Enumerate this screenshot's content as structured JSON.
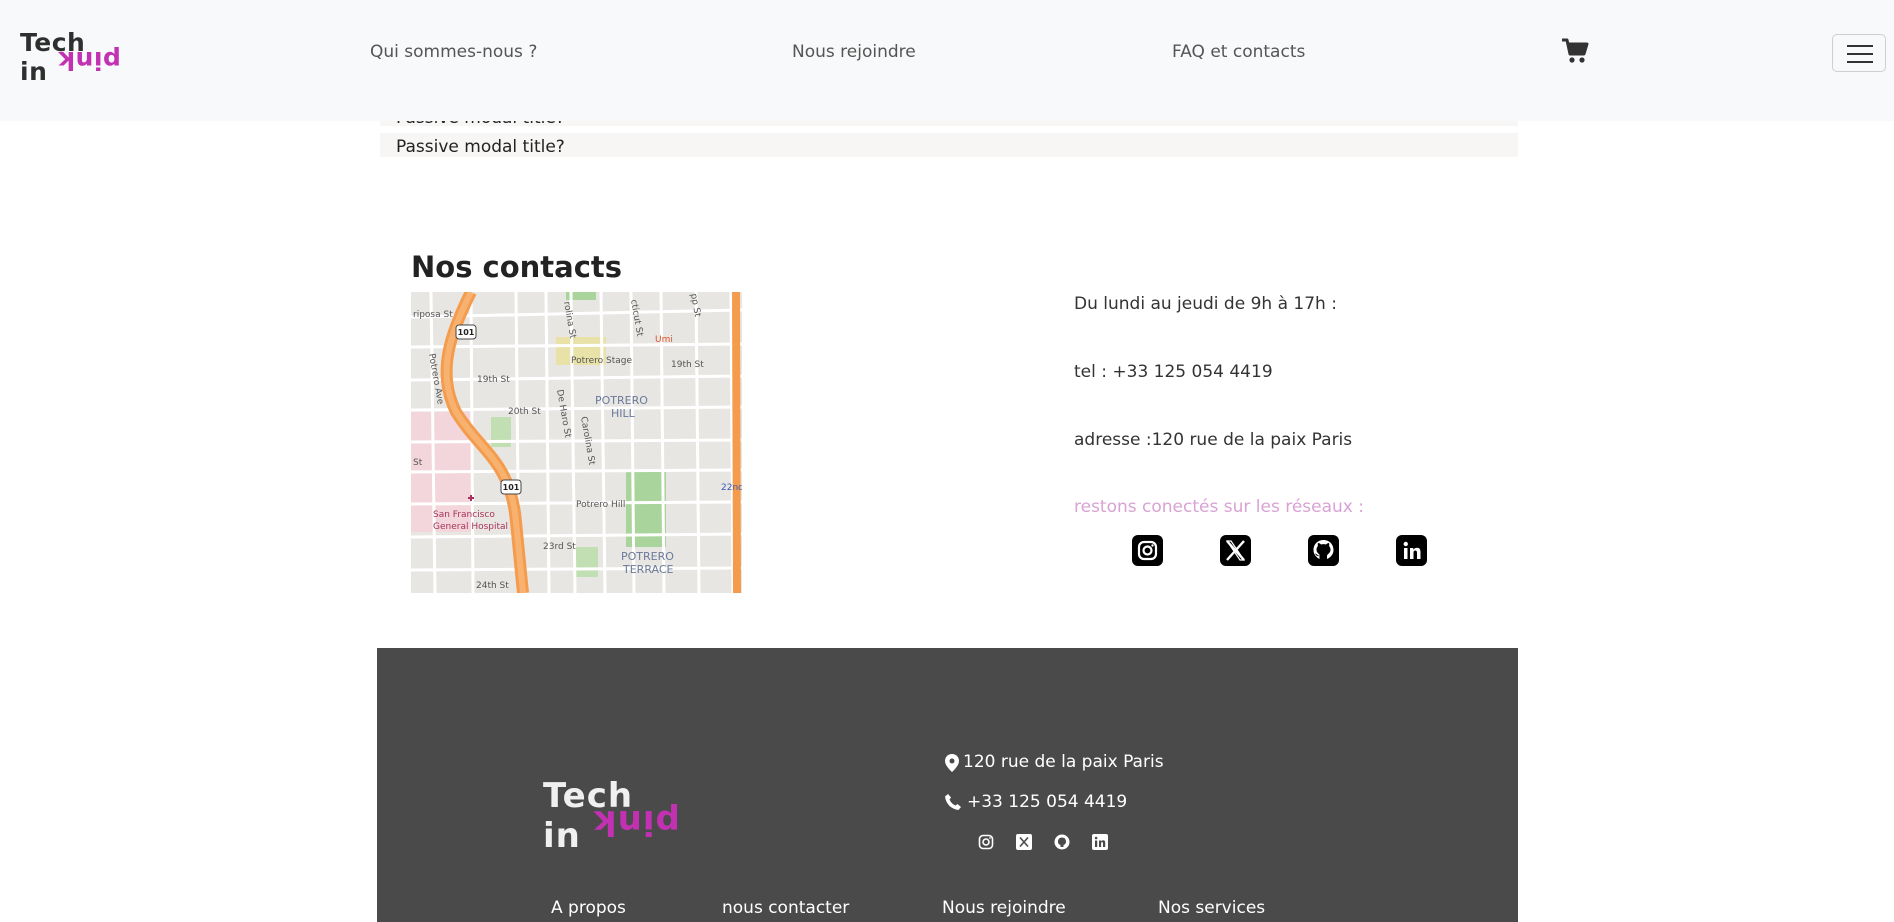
{
  "navbar": {
    "logo_top": "Tech in",
    "logo_bottom": "pink",
    "links": [
      "Qui sommes-nous ?",
      "Nous rejoindre",
      "FAQ et contacts"
    ],
    "cart_icon": "cart-icon",
    "menu_icon": "hamburger-icon"
  },
  "accordion": {
    "items": [
      "Passive modal title?",
      "Passive modal title?"
    ]
  },
  "contacts": {
    "title": "Nos contacts",
    "map_labels": {
      "mariposa": "riposa St",
      "potrero_ave": "Potrero Ave",
      "potrero_stage": "Potrero Stage",
      "umi": "Umi",
      "nineteenth_a": "19th St",
      "nineteenth_b": "19th St",
      "twentieth": "20th St",
      "de_haro": "De Haro St",
      "carolina": "Carolina St",
      "potrero_hill_1": "POTRERO",
      "potrero_hill_2": "HILL",
      "potrero_hill_poi": "Potrero Hill",
      "hospital_1": "San Francisco",
      "hospital_2": "General Hospital",
      "twentythird": "23rd St",
      "twentyfourth": "24th St",
      "terrace_1": "POTRERO",
      "terrace_2": "TERRACE",
      "twentysecond": "22nd",
      "hwy": "101",
      "rolina": "rolina St",
      "ticut": "cticut St",
      "pp": "pp St",
      "st_left": "St"
    },
    "hours": "Du lundi au jeudi de 9h à 17h :",
    "phone": "tel : +33 125 054 4419",
    "address": "adresse :120 rue de la paix Paris",
    "social_prompt": "restons conectés sur les réseaux :",
    "social_icons": [
      "instagram-icon",
      "x-icon",
      "github-icon",
      "linkedin-icon"
    ]
  },
  "footer": {
    "logo_top": "Tech in",
    "logo_bottom": "pink",
    "address": "120 rue de la paix Paris",
    "phone": "+33 125 054 4419",
    "links": [
      "A propos",
      "nous contacter",
      "Nous rejoindre",
      "Nos services"
    ]
  },
  "colors": {
    "brand_pink": "#c231b2",
    "footer_bg": "#4a4a4a",
    "navbar_bg": "#f8f9fa",
    "social_prompt": "#d9a2d4"
  }
}
